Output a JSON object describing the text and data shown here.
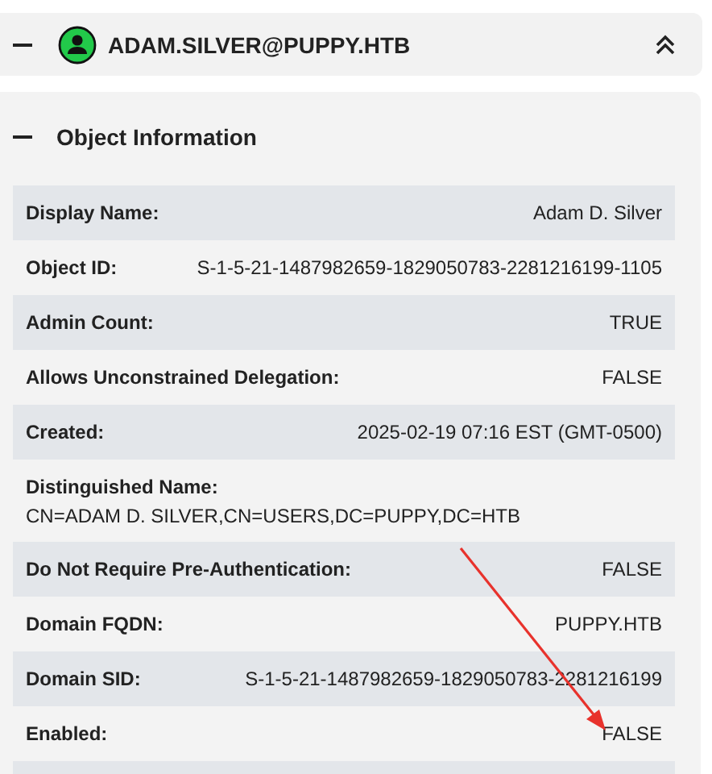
{
  "node": {
    "title": "ADAM.SILVER@PUPPY.HTB",
    "expanded": true
  },
  "section": {
    "title": "Object Information",
    "expanded": true
  },
  "properties": [
    {
      "kind": "inline",
      "label": "Display Name:",
      "value": "Adam D. Silver"
    },
    {
      "kind": "inline",
      "label": "Object ID:",
      "value": "S-1-5-21-1487982659-1829050783-2281216199-1105"
    },
    {
      "kind": "inline",
      "label": "Admin Count:",
      "value": "TRUE"
    },
    {
      "kind": "inline",
      "label": "Allows Unconstrained Delegation:",
      "value": "FALSE"
    },
    {
      "kind": "inline",
      "label": "Created:",
      "value": "2025-02-19 07:16 EST (GMT-0500)"
    },
    {
      "kind": "block",
      "label": "Distinguished Name:",
      "value": "CN=ADAM D. SILVER,CN=USERS,DC=PUPPY,DC=HTB"
    },
    {
      "kind": "inline",
      "label": "Do Not Require Pre-Authentication:",
      "value": "FALSE"
    },
    {
      "kind": "inline",
      "label": "Domain FQDN:",
      "value": "PUPPY.HTB"
    },
    {
      "kind": "inline",
      "label": "Domain SID:",
      "value": "S-1-5-21-1487982659-1829050783-2281216199"
    },
    {
      "kind": "inline",
      "label": "Enabled:",
      "value": "FALSE"
    }
  ]
}
